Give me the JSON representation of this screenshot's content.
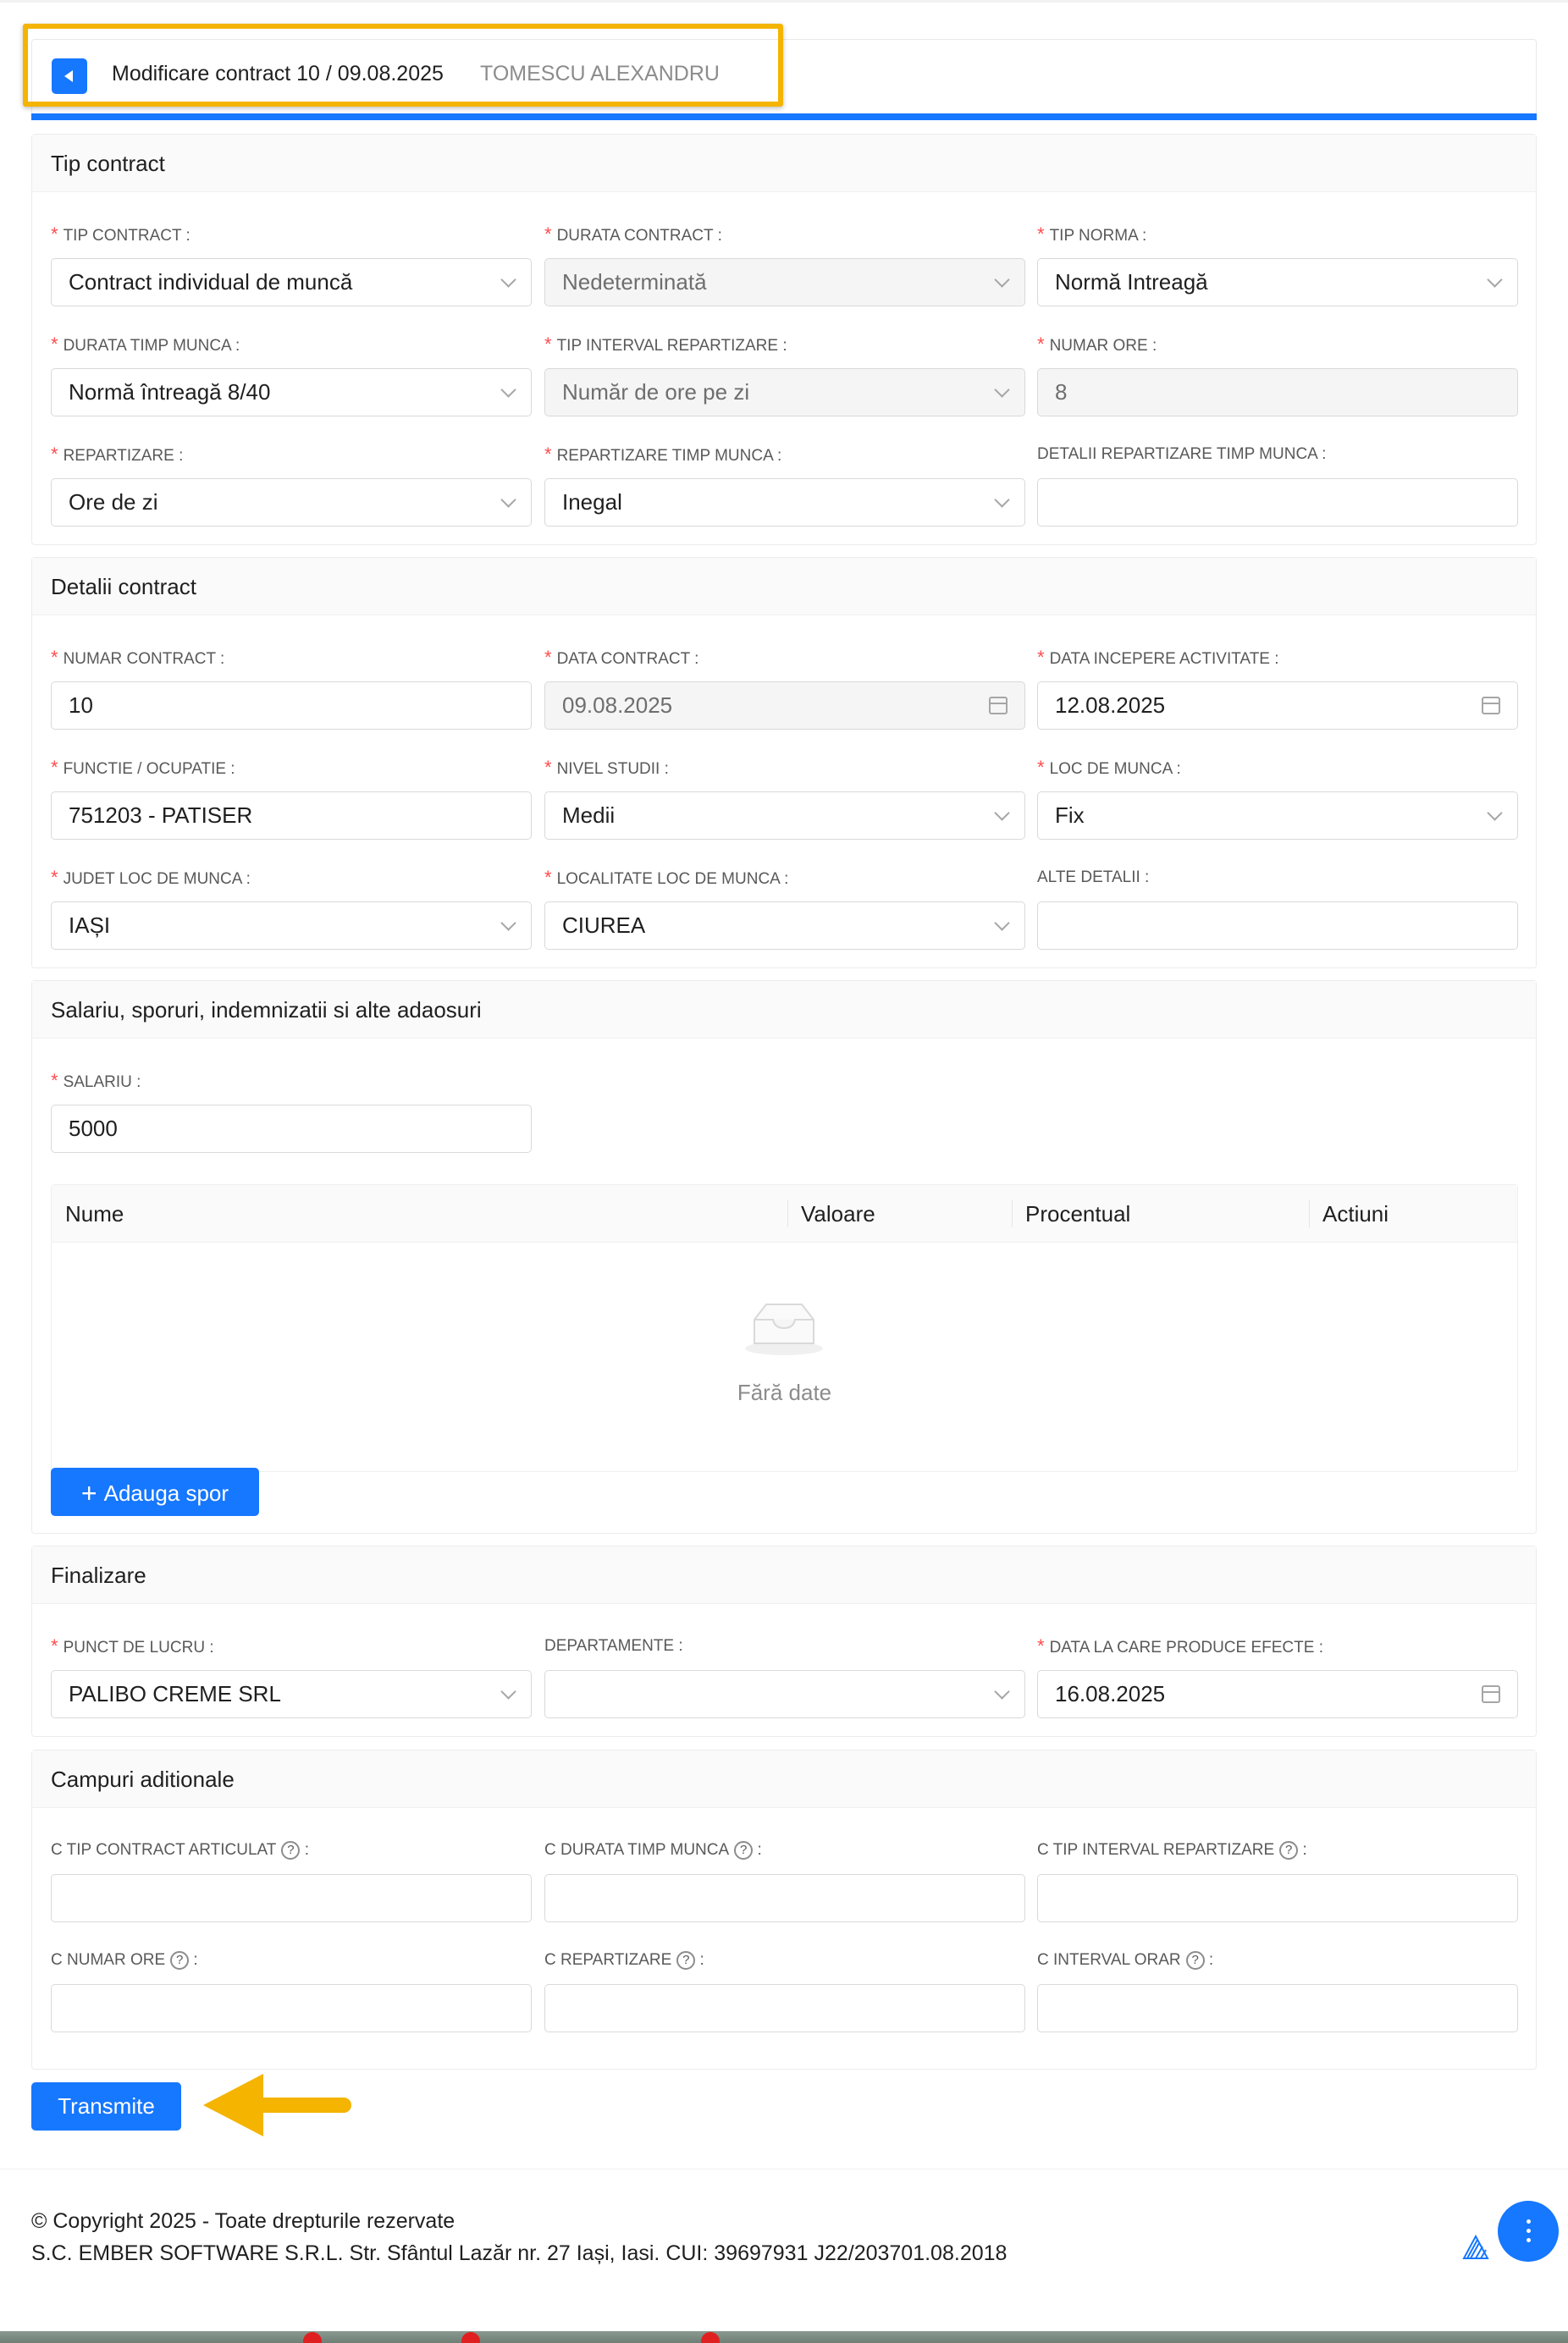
{
  "header": {
    "title": "Modificare contract 10 / 09.08.2025",
    "employee": "TOMESCU ALEXANDRU"
  },
  "tip_contract": {
    "heading": "Tip contract",
    "fields": [
      {
        "label": "TIP CONTRACT :",
        "value": "Contract individual de muncă"
      },
      {
        "label": "DURATA CONTRACT :",
        "value": "Nedeterminată"
      },
      {
        "label": "TIP NORMA :",
        "value": "Normă Intreagă"
      },
      {
        "label": "DURATA TIMP MUNCA :",
        "value": "Normă întreagă 8/40"
      },
      {
        "label": "TIP INTERVAL REPARTIZARE :",
        "value": "Număr de ore pe zi"
      },
      {
        "label": "NUMAR ORE :",
        "value": "8"
      },
      {
        "label": "REPARTIZARE :",
        "value": "Ore de zi"
      },
      {
        "label": "REPARTIZARE TIMP MUNCA :",
        "value": "Inegal"
      },
      {
        "label": "DETALII REPARTIZARE TIMP MUNCA :",
        "value": ""
      }
    ]
  },
  "detalii_contract": {
    "heading": "Detalii contract",
    "fields": [
      {
        "label": "NUMAR CONTRACT :",
        "value": "10"
      },
      {
        "label": "DATA CONTRACT :",
        "value": "09.08.2025"
      },
      {
        "label": "DATA INCEPERE ACTIVITATE :",
        "value": "12.08.2025"
      },
      {
        "label": "FUNCTIE / OCUPATIE :",
        "value": "751203 - PATISER"
      },
      {
        "label": "NIVEL STUDII :",
        "value": "Medii"
      },
      {
        "label": "LOC DE MUNCA :",
        "value": "Fix"
      },
      {
        "label": "JUDET LOC DE MUNCA :",
        "value": "IAȘI"
      },
      {
        "label": "LOCALITATE LOC DE MUNCA :",
        "value": "CIUREA"
      },
      {
        "label": "ALTE DETALII :",
        "value": ""
      }
    ]
  },
  "salariu": {
    "heading": "Salariu, sporuri, indemnizatii si alte adaosuri",
    "label": "SALARIU :",
    "value": "5000",
    "columns": [
      "Nume",
      "Valoare",
      "Procentual",
      "Actiuni"
    ],
    "empty_text": "Fără date",
    "add_button": "Adauga spor"
  },
  "finalizare": {
    "heading": "Finalizare",
    "fields": [
      {
        "label": "PUNCT DE LUCRU :",
        "value": "PALIBO CREME SRL"
      },
      {
        "label": "DEPARTAMENTE :",
        "value": ""
      },
      {
        "label": "DATA LA CARE PRODUCE EFECTE :",
        "value": "16.08.2025"
      }
    ]
  },
  "campuri": {
    "heading": "Campuri aditionale",
    "fields": [
      {
        "label": "C TIP CONTRACT ARTICULAT",
        "value": ""
      },
      {
        "label": "C DURATA TIMP MUNCA",
        "value": ""
      },
      {
        "label": "C TIP INTERVAL REPARTIZARE",
        "value": ""
      },
      {
        "label": "C NUMAR ORE",
        "value": ""
      },
      {
        "label": "C REPARTIZARE",
        "value": ""
      },
      {
        "label": "C INTERVAL ORAR",
        "value": ""
      }
    ],
    "help_glyph": "?",
    "suffix": ":"
  },
  "submit_button": "Transmite",
  "footer": {
    "copyright": "© Copyright 2025 - Toate drepturile rezervate",
    "company": "S.C. EMBER SOFTWARE S.R.L. Str. Sfântul Lazăr nr. 27 Iași, Iasi. CUI: 39697931 J22/203701.08.2018"
  },
  "colors": {
    "primary": "#1677ff",
    "highlight": "#f4b400",
    "required": "#ff4d4f"
  },
  "icons": [
    "back-caret-icon",
    "chevron-down-icon",
    "calendar-icon",
    "question-circle-icon",
    "plus-icon",
    "empty-inbox-icon",
    "more-vertical-icon",
    "arrow-annotation-icon"
  ]
}
